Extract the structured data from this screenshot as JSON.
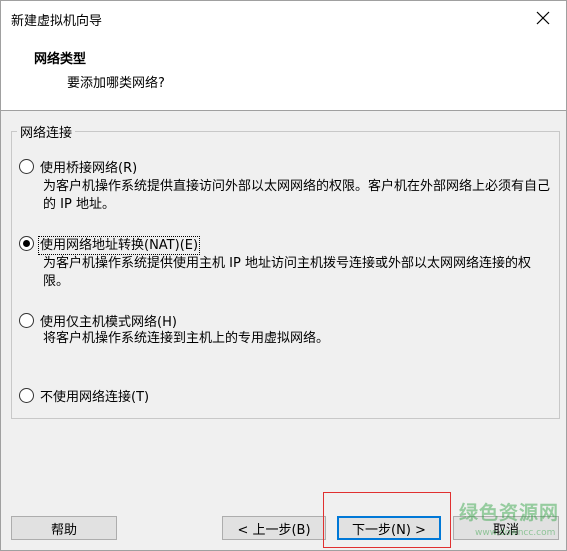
{
  "window": {
    "title": "新建虚拟机向导"
  },
  "header": {
    "title": "网络类型",
    "subtitle": "要添加哪类网络?"
  },
  "group": {
    "label": "网络连接"
  },
  "options": [
    {
      "label": "使用桥接网络(R)",
      "description": "为客户机操作系统提供直接访问外部以太网网络的权限。客户机在外部网络上必须有自己的 IP 地址。",
      "selected": false
    },
    {
      "label": "使用网络地址转换(NAT)(E)",
      "description": "为客户机操作系统提供使用主机 IP 地址访问主机拨号连接或外部以太网网络连接的权限。",
      "selected": true
    },
    {
      "label": "使用仅主机模式网络(H)",
      "description": "将客户机操作系统连接到主机上的专用虚拟网络。",
      "selected": false
    },
    {
      "label": "不使用网络连接(T)",
      "description": "",
      "selected": false
    }
  ],
  "buttons": {
    "help": "帮助",
    "back": "< 上一步(B)",
    "next": "下一步(N) >",
    "cancel": "取消"
  },
  "watermark": {
    "text": "绿色资源网",
    "url": "www.downcc.com"
  },
  "icons": {
    "close": "close-icon"
  },
  "colors": {
    "accent": "#0078d7",
    "highlight_box": "#e03030",
    "watermark": "#28a03c"
  }
}
